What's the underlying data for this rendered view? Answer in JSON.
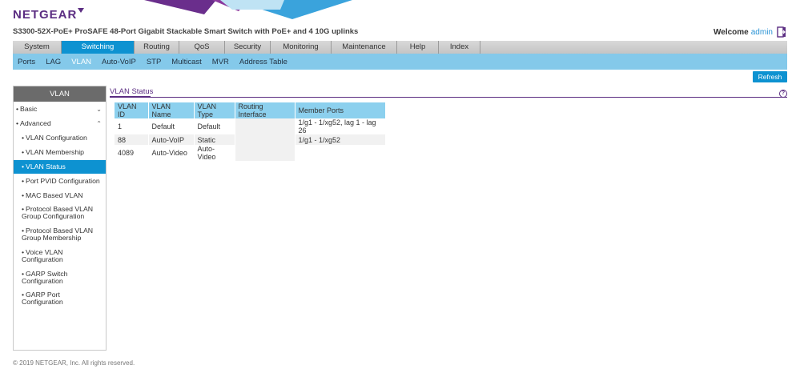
{
  "header": {
    "logo": "NETGEAR",
    "product_title": "S3300-52X-PoE+ ProSAFE 48-Port Gigabit Stackable Smart Switch with PoE+ and 4 10G uplinks",
    "welcome_label": "Welcome",
    "user": "admin",
    "logout_icon": "logout-icon",
    "colors": {
      "brand": "#5b2d82",
      "accent": "#0d92d1",
      "subnav": "#84c9ea"
    }
  },
  "main_nav": {
    "tabs": [
      {
        "label": "System"
      },
      {
        "label": "Switching",
        "active": true
      },
      {
        "label": "Routing"
      },
      {
        "label": "QoS"
      },
      {
        "label": "Security"
      },
      {
        "label": "Monitoring"
      },
      {
        "label": "Maintenance"
      },
      {
        "label": "Help"
      },
      {
        "label": "Index"
      }
    ]
  },
  "sub_nav": {
    "items": [
      {
        "label": "Ports"
      },
      {
        "label": "LAG"
      },
      {
        "label": "VLAN",
        "active": true
      },
      {
        "label": "Auto-VoIP"
      },
      {
        "label": "STP"
      },
      {
        "label": "Multicast"
      },
      {
        "label": "MVR"
      },
      {
        "label": "Address Table"
      }
    ]
  },
  "toolbar": {
    "refresh_label": "Refresh"
  },
  "sidebar": {
    "title": "VLAN",
    "basic": "Basic",
    "advanced": "Advanced",
    "items": [
      {
        "label": "VLAN Configuration"
      },
      {
        "label": "VLAN Membership"
      },
      {
        "label": "VLAN Status",
        "active": true
      },
      {
        "label": "Port PVID Configuration"
      },
      {
        "label": "MAC Based VLAN"
      },
      {
        "label": "Protocol Based VLAN Group Configuration"
      },
      {
        "label": "Protocol Based VLAN Group Membership"
      },
      {
        "label": "Voice VLAN Configuration"
      },
      {
        "label": "GARP Switch Configuration"
      },
      {
        "label": "GARP Port Configuration"
      }
    ]
  },
  "content": {
    "section_title": "VLAN Status",
    "help_icon": "help-icon",
    "table": {
      "headers": [
        "VLAN ID",
        "VLAN Name",
        "VLAN Type",
        "Routing Interface",
        "Member Ports"
      ],
      "rows": [
        [
          "1",
          "Default",
          "Default",
          "",
          "1/g1 - 1/xg52, lag 1 - lag 26"
        ],
        [
          "88",
          "Auto-VoIP",
          "Static",
          "",
          "1/g1 - 1/xg52"
        ],
        [
          "4089",
          "Auto-Video",
          "Auto-Video",
          "",
          ""
        ]
      ]
    }
  },
  "footer": {
    "copyright": "© 2019 NETGEAR, Inc. All rights reserved."
  }
}
